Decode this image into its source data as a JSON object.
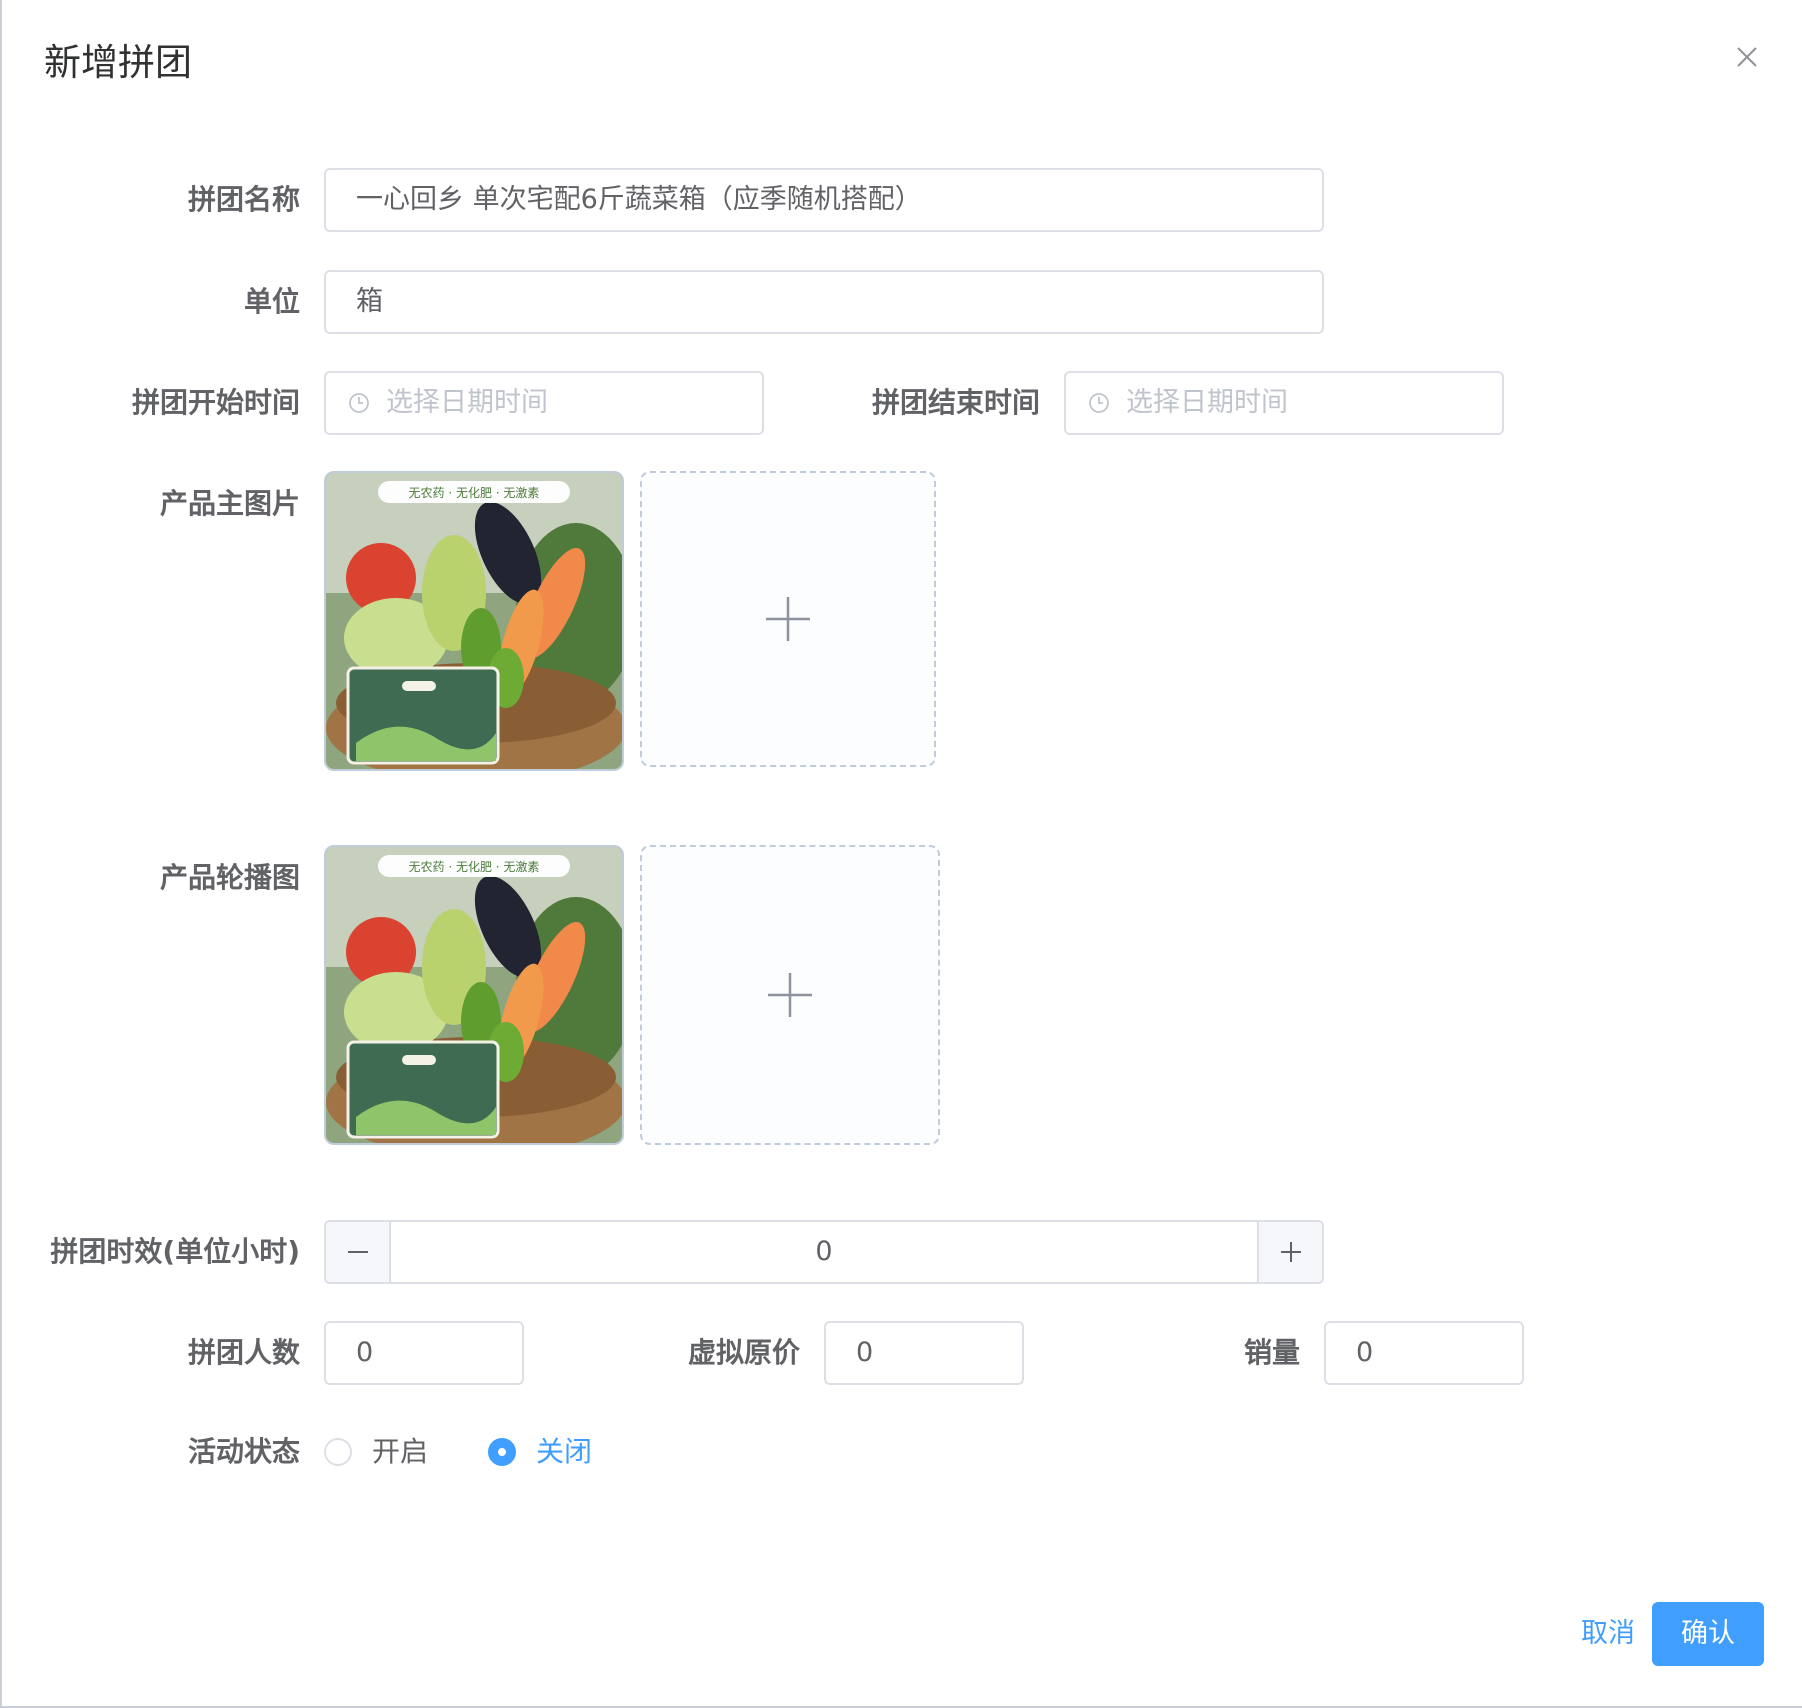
{
  "dialog": {
    "title": "新增拼团"
  },
  "form": {
    "name": {
      "label": "拼团名称",
      "value": "一心回乡    单次宅配6斤蔬菜箱（应季随机搭配）"
    },
    "unit": {
      "label": "单位",
      "value": "箱"
    },
    "start_time": {
      "label": "拼团开始时间",
      "placeholder": "选择日期时间"
    },
    "end_time": {
      "label": "拼团结束时间",
      "placeholder": "选择日期时间"
    },
    "main_image": {
      "label": "产品主图片",
      "image_banner": "无农药 · 无化肥 · 无激素"
    },
    "carousel": {
      "label": "产品轮播图",
      "image_banner": "无农药 · 无化肥 · 无激素"
    },
    "duration": {
      "label": "拼团时效(单位小时)",
      "value": "0"
    },
    "people": {
      "label": "拼团人数",
      "value": "0"
    },
    "virtual_price": {
      "label": "虚拟原价",
      "value": "0"
    },
    "sales": {
      "label": "销量",
      "value": "0"
    },
    "status": {
      "label": "活动状态",
      "options": [
        "开启",
        "关闭"
      ],
      "selected": "关闭"
    }
  },
  "footer": {
    "cancel_label": "取消",
    "confirm_label": "确认"
  },
  "colors": {
    "primary": "#409eff",
    "border": "#dcdfe6",
    "label": "#606266",
    "placeholder": "#c0c4cc"
  },
  "icons": [
    "close-icon",
    "clock-icon",
    "plus-icon",
    "minus-icon"
  ]
}
